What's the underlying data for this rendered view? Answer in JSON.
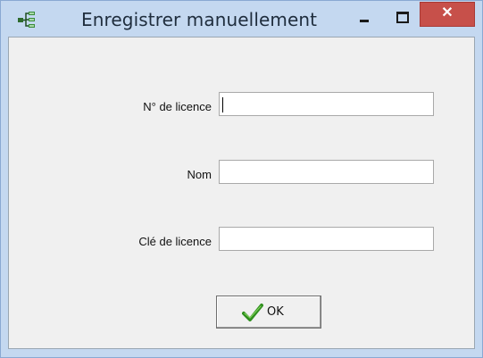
{
  "window": {
    "title": "Enregistrer manuellement",
    "close_label": "✕",
    "accent": "#c4d8f0",
    "close_color": "#c7504a"
  },
  "form": {
    "license_number": {
      "label": "N° de licence",
      "value": ""
    },
    "name": {
      "label": "Nom",
      "value": ""
    },
    "license_key": {
      "label": "Clé de licence",
      "value": ""
    }
  },
  "buttons": {
    "ok_label": "OK",
    "ok_icon": "checkmark-icon"
  },
  "icons": {
    "app_icon": "network-tree-icon",
    "minimize": "minimize-icon",
    "maximize": "maximize-icon",
    "close": "close-icon"
  }
}
